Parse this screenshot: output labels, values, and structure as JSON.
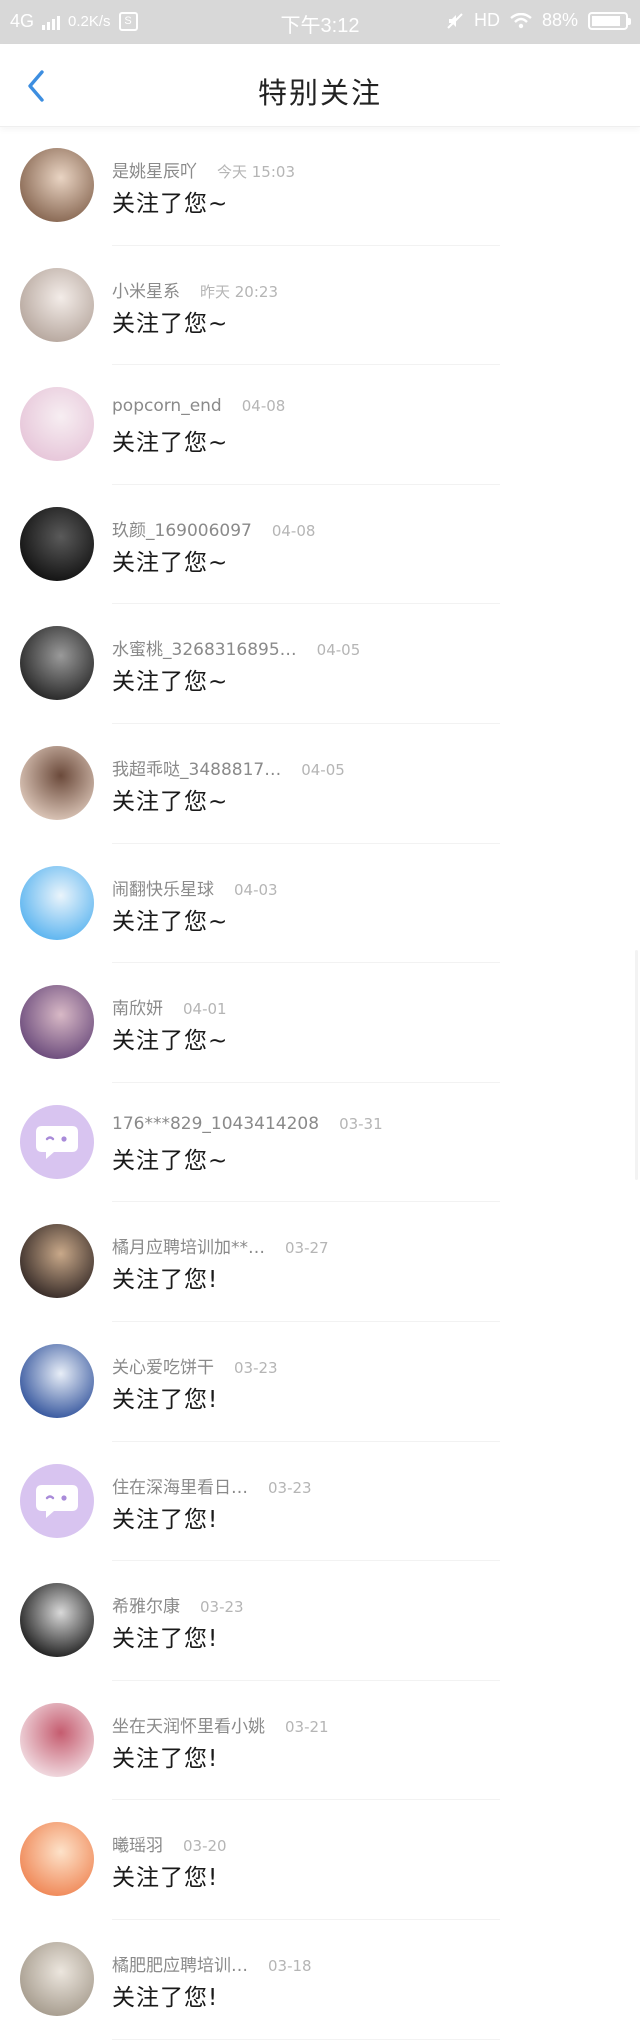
{
  "status_bar": {
    "network": "4G",
    "speed": "0.2K/s",
    "s_badge": "S",
    "time": "下午3:12",
    "hd": "HD",
    "battery": "88%",
    "battery_level": 0.88
  },
  "header": {
    "title": "特别关注",
    "back_icon": "chevron-left-icon",
    "accent_color": "#3d8ee0"
  },
  "items": [
    {
      "name": "是姚星辰吖",
      "time": "今天 15:03",
      "message": "关注了您~",
      "avatar": "photo"
    },
    {
      "name": "小米星系",
      "time": "昨天 20:23",
      "message": "关注了您~",
      "avatar": "photo"
    },
    {
      "name": "popcorn_end",
      "time": "04-08",
      "message": "关注了您~",
      "avatar": "photo"
    },
    {
      "name": "玖颜_169006097",
      "time": "04-08",
      "message": "关注了您~",
      "avatar": "photo"
    },
    {
      "name": "水蜜桃_3268316895…",
      "time": "04-05",
      "message": "关注了您~",
      "avatar": "photo"
    },
    {
      "name": "我超乖哒_3488817…",
      "time": "04-05",
      "message": "关注了您~",
      "avatar": "photo"
    },
    {
      "name": "闹翻快乐星球",
      "time": "04-03",
      "message": "关注了您~",
      "avatar": "photo"
    },
    {
      "name": "南欣妍",
      "time": "04-01",
      "message": "关注了您~",
      "avatar": "photo"
    },
    {
      "name": "176***829_1043414208",
      "time": "03-31",
      "message": "关注了您~",
      "avatar": "chat-default"
    },
    {
      "name": "橘月应聘培训加**…",
      "time": "03-27",
      "message": "关注了您!",
      "avatar": "photo"
    },
    {
      "name": "关心爱吃饼干",
      "time": "03-23",
      "message": "关注了您!",
      "avatar": "photo"
    },
    {
      "name": "住在深海里看日…",
      "time": "03-23",
      "message": "关注了您!",
      "avatar": "chat-default"
    },
    {
      "name": "希雅尔康",
      "time": "03-23",
      "message": "关注了您!",
      "avatar": "photo"
    },
    {
      "name": "坐在天润怀里看小姚",
      "time": "03-21",
      "message": "关注了您!",
      "avatar": "photo"
    },
    {
      "name": "曦瑶羽",
      "time": "03-20",
      "message": "关注了您!",
      "avatar": "photo"
    },
    {
      "name": "橘肥肥应聘培训…",
      "time": "03-18",
      "message": "关注了您!",
      "avatar": "photo"
    }
  ]
}
